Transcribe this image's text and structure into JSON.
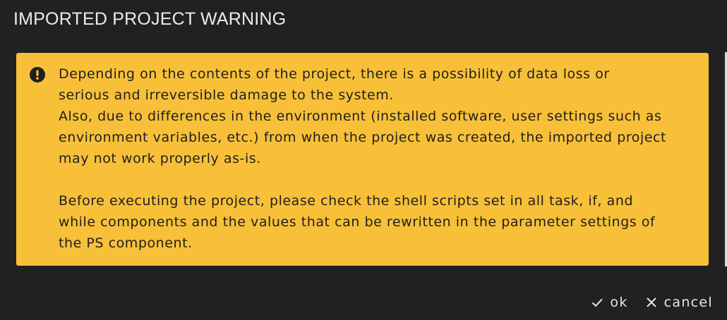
{
  "dialog": {
    "title": "IMPORTED PROJECT WARNING"
  },
  "warning": {
    "icon": "alert-circle-icon",
    "background_color": "#f8c038",
    "lines": [
      "Depending on the contents of the project, there is a possibility of data loss or",
      "serious and irreversible damage to the system.",
      "Also, due to differences in the environment (installed software, user settings such as",
      "environment variables, etc.) from when the project was created, the imported project",
      "may not work properly as-is.",
      "",
      "Before executing the project, please check the shell scripts set in all task, if, and",
      "while components and the values that can be rewritten in the parameter settings of",
      "the PS component."
    ]
  },
  "actions": {
    "ok": {
      "label": "ok",
      "icon": "check-icon"
    },
    "cancel": {
      "label": "cancel",
      "icon": "close-icon"
    }
  }
}
